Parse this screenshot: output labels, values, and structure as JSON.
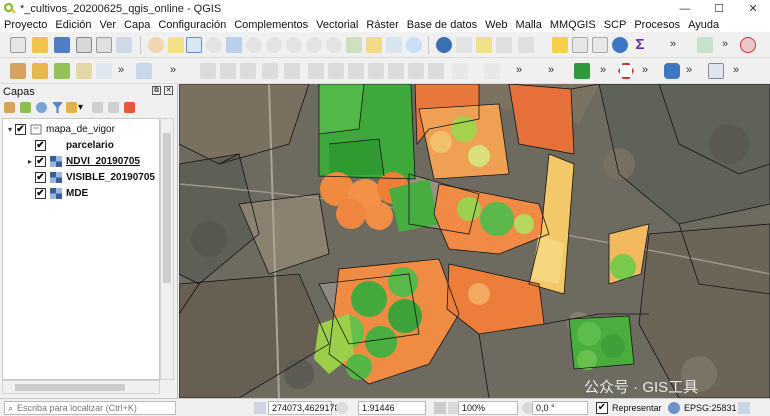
{
  "window": {
    "title": "*_cultivos_20200625_qgis_online - QGIS",
    "minimize": "—",
    "maximize": "☐",
    "close": "✕"
  },
  "menu": [
    "Proyecto",
    "Edición",
    "Ver",
    "Capa",
    "Configuración",
    "Complementos",
    "Vectorial",
    "Ráster",
    "Base de datos",
    "Web",
    "Malla",
    "MMQGIS",
    "SCP",
    "Procesos",
    "Ayuda"
  ],
  "toolbar": {
    "more": "»"
  },
  "layers_panel": {
    "title": "Capas",
    "controls": [
      "⧉",
      "✕"
    ],
    "tree": [
      {
        "label": "mapa_de_vigor",
        "checked": true,
        "type": "group",
        "expanded": true
      },
      {
        "label": "parcelario",
        "checked": true,
        "type": "vector"
      },
      {
        "label": "NDVI_20190705",
        "checked": true,
        "type": "raster",
        "selected": true
      },
      {
        "label": "VISIBLE_20190705",
        "checked": true,
        "type": "raster"
      },
      {
        "label": "MDE",
        "checked": true,
        "type": "raster"
      }
    ],
    "check_mark": "✔",
    "expand_arrow": "▾",
    "collapsed_arrow": "▸"
  },
  "statusbar": {
    "locator_placeholder": "Escriba para localizar (Ctrl+K)",
    "coordinate": "274073,4629178",
    "scale": "1:91446",
    "magnifier": "100%",
    "rotation": "0,0 °",
    "render_label": "Representar",
    "crs": "EPSG:25831"
  },
  "watermark": "公众号 · GIS工具",
  "colors": {
    "ndvi_high": "#2e9e2e",
    "ndvi_mid": "#a7d44a",
    "ndvi_low": "#ff8c3a",
    "ndvi_lowest": "#e8583a",
    "parcel_line": "#1a1a1a",
    "satellite_base": "#6f6a5f"
  }
}
